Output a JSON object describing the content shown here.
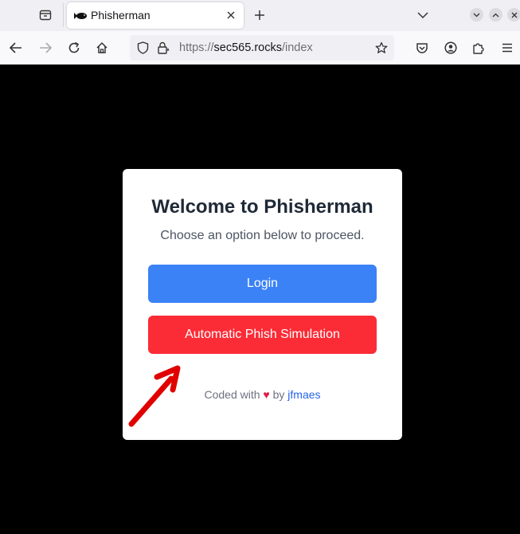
{
  "browser": {
    "tab": {
      "title": "Phisherman"
    },
    "url": {
      "scheme": "https://",
      "host": "sec565.rocks",
      "path": "/index"
    }
  },
  "page": {
    "heading": "Welcome to Phisherman",
    "subheading": "Choose an option below to proceed.",
    "login_label": "Login",
    "phish_label": "Automatic Phish Simulation",
    "footer": {
      "prefix": "Coded with",
      "heart": "♥",
      "by": "by",
      "author": "jfmaes"
    }
  },
  "colors": {
    "login": "#3b82f6",
    "phish": "#fb2c36",
    "annotation_arrow": "#e00000"
  }
}
